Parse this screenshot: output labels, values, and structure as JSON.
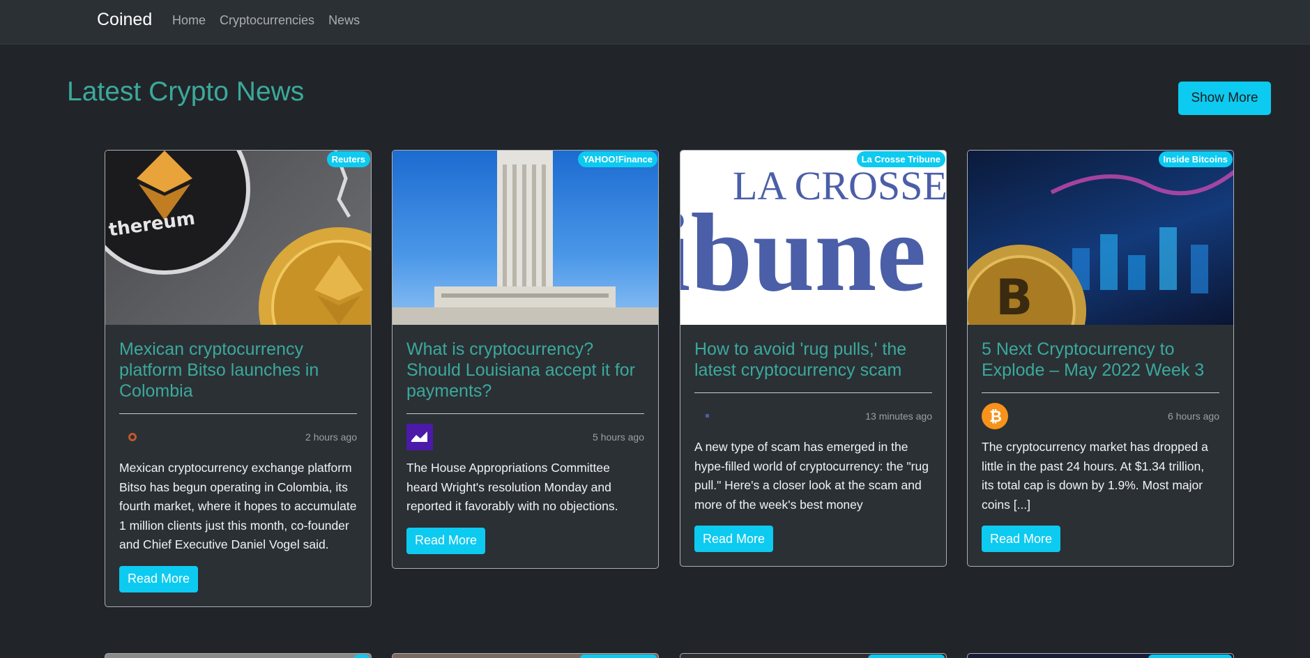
{
  "navbar": {
    "brand": "Coined",
    "links": [
      "Home",
      "Cryptocurrencies",
      "News"
    ]
  },
  "page": {
    "title": "Latest Crypto News",
    "show_more_label": "Show More"
  },
  "cards": [
    {
      "source": "Reuters",
      "title": "Mexican cryptocurrency platform Bitso launches in Colombia",
      "time": "2 hours ago",
      "description": "Mexican cryptocurrency exchange platform Bitso has begun operating in Colombia, its fourth market, where it hopes to accumulate 1 million clients just this month, co-founder and Chief Executive Daniel Vogel said.",
      "read_more": "Read More",
      "provider_icon": "reuters-icon",
      "image_icon": "ethereum-coins-image"
    },
    {
      "source": "YAHOO!Finance",
      "title": "What is cryptocurrency? Should Louisiana accept it for payments?",
      "time": "5 hours ago",
      "description": "The House Appropriations Committee heard Wright's resolution Monday and reported it favorably with no objections.",
      "read_more": "Read More",
      "provider_icon": "yahoo-finance-icon",
      "image_icon": "louisiana-capitol-image"
    },
    {
      "source": "La Crosse Tribune",
      "title": "How to avoid 'rug pulls,' the latest cryptocurrency scam",
      "time": "13 minutes ago",
      "description": "A new type of scam has emerged in the hype-filled world of cryptocurrency: the \"rug pull.\" Here's a closer look at the scam and more of the week's best money",
      "read_more": "Read More",
      "provider_icon": "la-crosse-tribune-icon",
      "image_icon": "la-crosse-tribune-logo-image",
      "image_text_line1": "LA CROSSE",
      "image_text_line2": "ibune"
    },
    {
      "source": "Inside Bitcoins",
      "title": "5 Next Cryptocurrency to Explode – May 2022 Week 3",
      "time": "6 hours ago",
      "description": "The cryptocurrency market has dropped a little in the past 24 hours. At $1.34 trillion, its total cap is down by 1.9%. Most major coins [...]",
      "read_more": "Read More",
      "provider_icon": "bitcoin-icon",
      "image_icon": "bitcoin-chart-image"
    }
  ],
  "colors": {
    "background": "#212529",
    "navbar": "#2b3035",
    "accent_teal": "#3ba99c",
    "button_cyan": "#0dcaf0"
  }
}
